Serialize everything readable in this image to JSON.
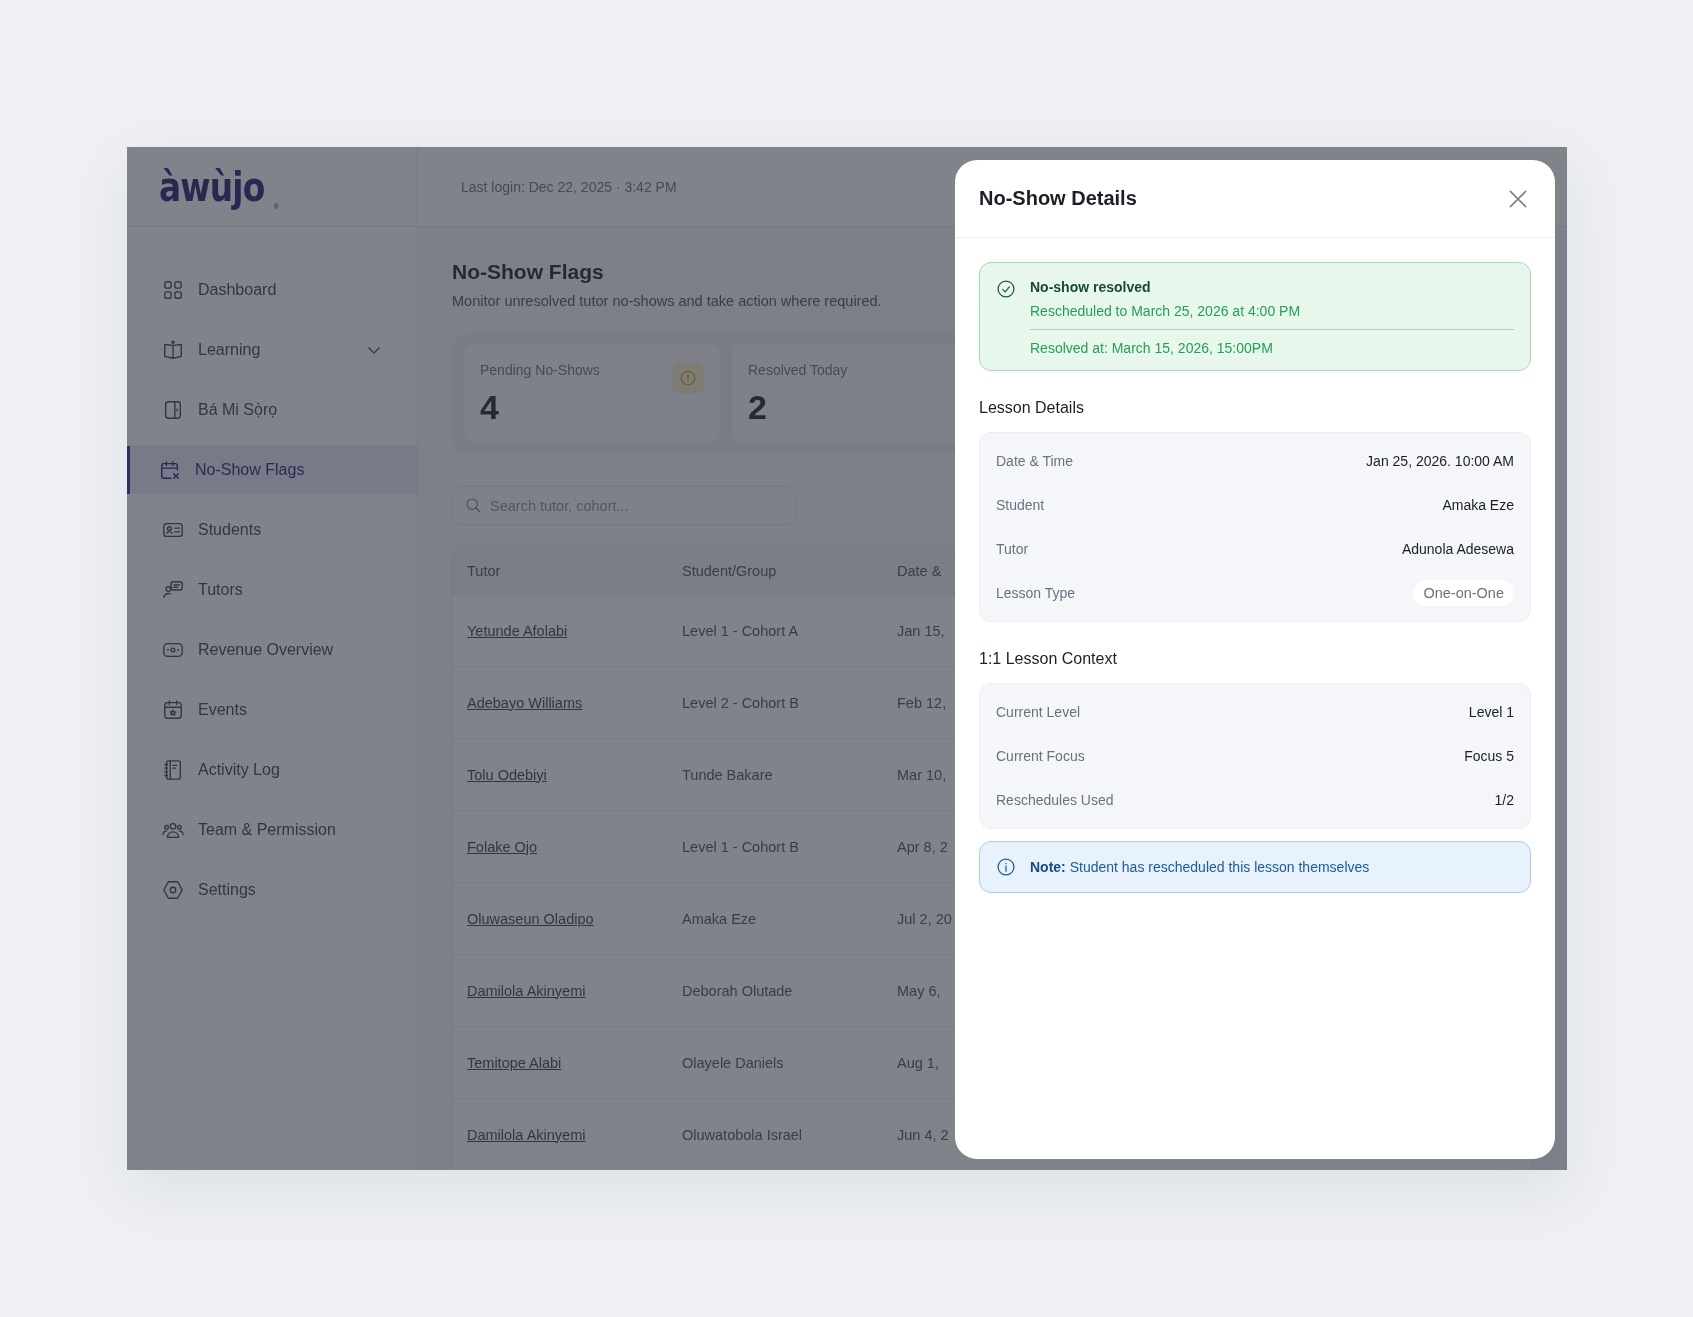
{
  "app": {
    "logo": "àwùjo",
    "logo_mark": "®",
    "last_login": "Last login: Dec 22, 2025 · 3:42 PM"
  },
  "sidebar": {
    "items": [
      {
        "label": "Dashboard",
        "kind": "link",
        "selected": false
      },
      {
        "label": "Learning",
        "kind": "group",
        "selected": false
      },
      {
        "label": "Bá Mi Sọ̀rọ",
        "kind": "link",
        "selected": false
      },
      {
        "label": "No-Show Flags",
        "kind": "link",
        "selected": true
      },
      {
        "label": "Students",
        "kind": "link",
        "selected": false
      },
      {
        "label": "Tutors",
        "kind": "link",
        "selected": false
      },
      {
        "label": "Revenue Overview",
        "kind": "link",
        "selected": false
      },
      {
        "label": "Events",
        "kind": "link",
        "selected": false
      },
      {
        "label": "Activity Log",
        "kind": "link",
        "selected": false
      },
      {
        "label": "Team & Permission",
        "kind": "link",
        "selected": false
      },
      {
        "label": "Settings",
        "kind": "link",
        "selected": false
      }
    ]
  },
  "page": {
    "title": "No-Show Flags",
    "subtitle": "Monitor unresolved tutor no-shows and take action where required.",
    "stats": [
      {
        "label": "Pending No-Shows",
        "value": "4"
      },
      {
        "label": "Resolved Today",
        "value": "2"
      }
    ],
    "search": {
      "placeholder": "Search tutor, cohort..."
    },
    "table": {
      "columns": [
        "Tutor",
        "Student/Group",
        "Date &"
      ],
      "rows": [
        [
          "Yetunde Afolabi",
          "Level 1 - Cohort A",
          "Jan 15,"
        ],
        [
          "Adebayo Williams",
          "Level 2 - Cohort B",
          "Feb 12,"
        ],
        [
          "Tolu Odebiyi",
          "Tunde Bakare",
          "Mar 10,"
        ],
        [
          "Folake Ojo",
          "Level 1 - Cohort B",
          "Apr 8, 2"
        ],
        [
          "Oluwaseun Oladipo",
          "Amaka Eze",
          "Jul 2, 20"
        ],
        [
          "Damilola Akinyemi",
          "Deborah Olutade",
          "May 6,"
        ],
        [
          "Temitope Alabi",
          "Olayele Daniels",
          "Aug 1,"
        ],
        [
          "Damilola Akinyemi",
          "Oluwatobola Israel",
          "Jun 4, 2"
        ]
      ]
    }
  },
  "modal": {
    "title": "No-Show Details",
    "status": {
      "kind": "resolved",
      "title": "No-show resolved",
      "detail": "Rescheduled to March 25, 2026 at 4:00 PM",
      "footer": "Resolved at: March 15, 2026, 15:00PM"
    },
    "sections": [
      {
        "title": "Lesson Details",
        "rows": [
          {
            "label": "Date & Time",
            "value": "Jan 25, 2026. 10:00 AM",
            "kind": "text"
          },
          {
            "label": "Student",
            "value": "Amaka Eze",
            "kind": "text"
          },
          {
            "label": "Tutor",
            "value": "Adunola Adesewa",
            "kind": "text"
          },
          {
            "label": "Lesson Type",
            "value": "One-on-One",
            "kind": "pill"
          }
        ]
      },
      {
        "title": "1:1 Lesson Context",
        "rows": [
          {
            "label": "Current Level",
            "value": "Level 1",
            "kind": "text"
          },
          {
            "label": "Current Focus",
            "value": "Focus 5",
            "kind": "text"
          },
          {
            "label": "Reschedules Used",
            "value": "1/2",
            "kind": "text"
          }
        ]
      }
    ],
    "note": "**Note:** Student has rescheduled this lesson themselves"
  }
}
